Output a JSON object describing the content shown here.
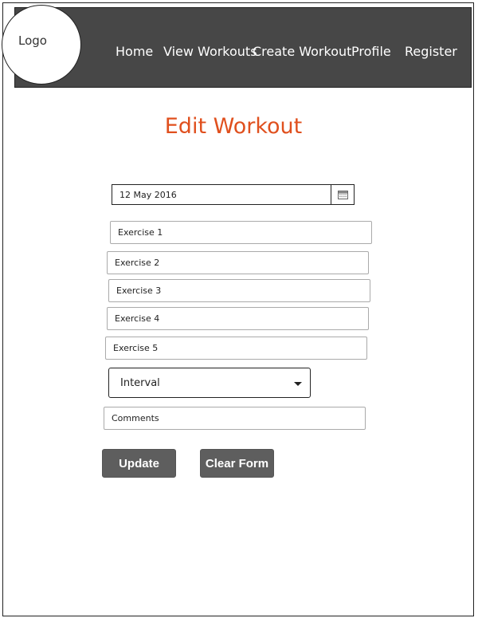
{
  "header": {
    "logo_label": "Logo",
    "nav": [
      {
        "label": "Home"
      },
      {
        "label": "View Workouts"
      },
      {
        "label": "Create Workout"
      },
      {
        "label": "Profile"
      },
      {
        "label": "Register"
      }
    ]
  },
  "page": {
    "title": "Edit Workout"
  },
  "form": {
    "date_value": "12 May 2016",
    "exercises": [
      {
        "placeholder": "Exercise 1"
      },
      {
        "placeholder": "Exercise 2"
      },
      {
        "placeholder": "Exercise 3"
      },
      {
        "placeholder": "Exercise 4"
      },
      {
        "placeholder": "Exercise 5"
      }
    ],
    "workout_type": "Interval",
    "comments_placeholder": "Comments",
    "update_label": "Update",
    "clear_label": "Clear Form"
  },
  "colors": {
    "title_accent": "#e0501e",
    "nav_background": "#474747",
    "button_background": "#5e5e5e"
  },
  "icons": {
    "date_picker": "calendar-icon",
    "select_toggle": "caret-down-icon"
  }
}
